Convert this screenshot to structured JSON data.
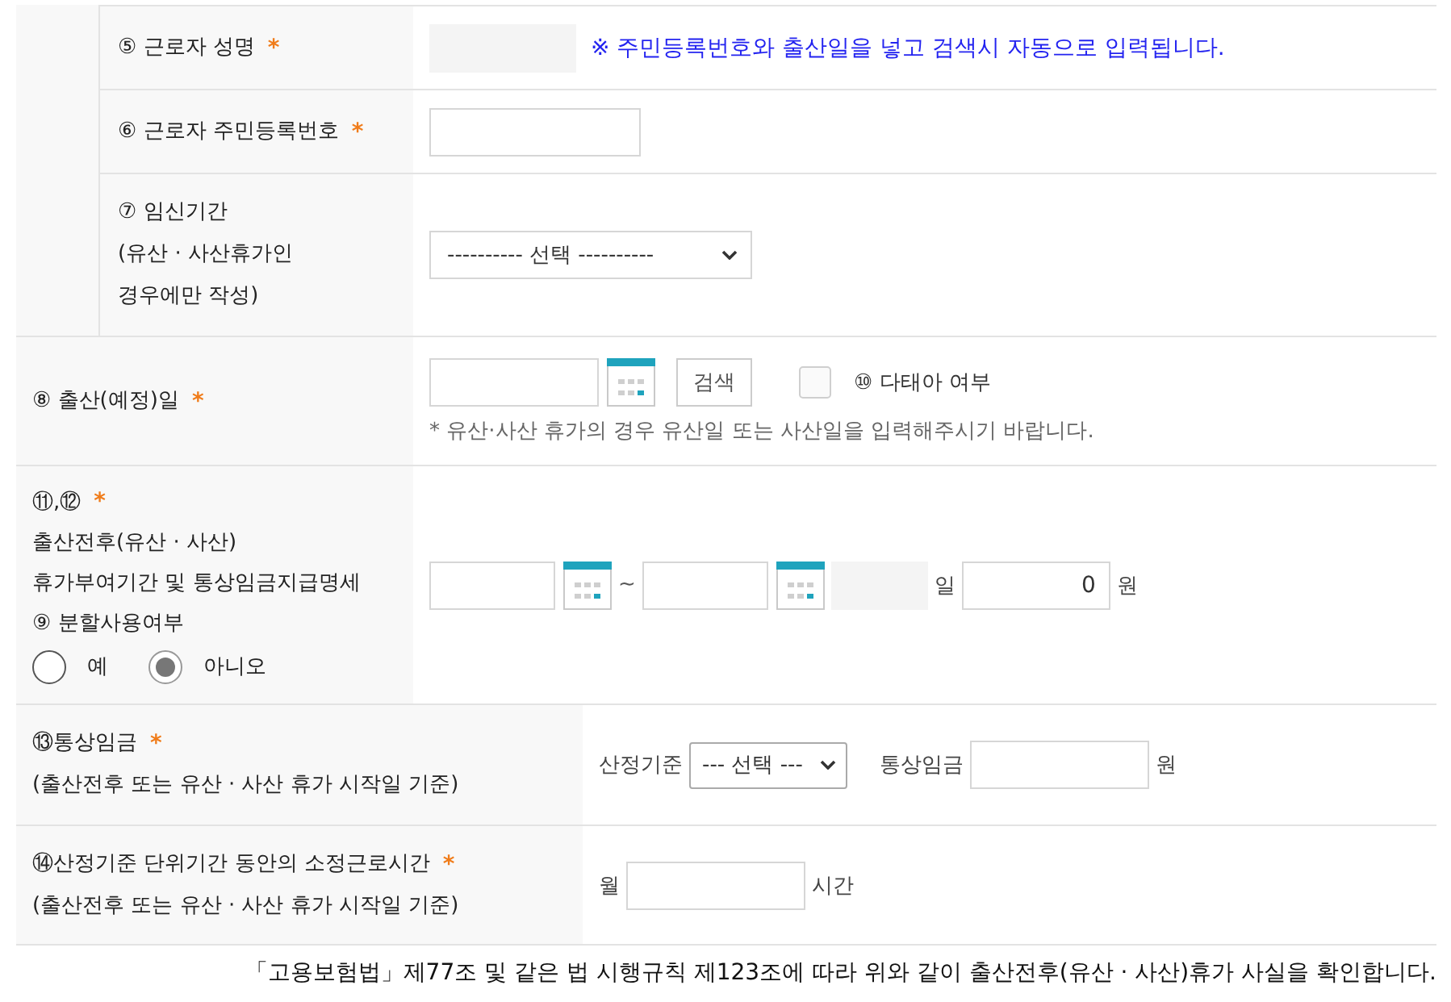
{
  "form": {
    "sections": [
      {
        "kind": "grouped",
        "rows": [
          {
            "kind": "name",
            "label_lines": [
              "⑤ 근로자 성명"
            ],
            "required_mark": "*",
            "lines": [
              [
                {
                  "kind": "readonly-field"
                },
                {
                  "kind": "note",
                  "text": "※ 주민등록번호와 출산일을 넣고 검색시 자동으로 입력됩니다."
                }
              ]
            ]
          },
          {
            "kind": "resident-number",
            "label_lines": [
              "⑥ 근로자 주민등록번호"
            ],
            "required_mark": "*",
            "lines": [
              [
                {
                  "kind": "text-field"
                }
              ]
            ]
          },
          {
            "kind": "pregnancy-period",
            "label_lines": [
              "⑦ 임신기간",
              "(유산 · 사산휴가인",
              "경우에만 작성)"
            ],
            "lines": [
              [
                {
                  "kind": "select",
                  "value": "---------- 선택 ----------"
                }
              ]
            ]
          }
        ]
      },
      {
        "kind": "plain",
        "rows": [
          {
            "kind": "birth-date",
            "label_lines": [
              "⑧ 출산(예정)일"
            ],
            "required_mark": "*",
            "lines": [
              [
                {
                  "kind": "date-field"
                },
                {
                  "kind": "calendar-button"
                },
                {
                  "kind": "button",
                  "label": "검색"
                },
                {
                  "kind": "checkbox",
                  "checked": false,
                  "label": "⑩ 다태아 여부"
                }
              ],
              [
                {
                  "kind": "hint",
                  "text": "* 유산·사산 휴가의 경우 유산일 또는 사산일을 입력해주시기 바랍니다."
                }
              ]
            ]
          },
          {
            "kind": "leave-period",
            "label_lines": [
              "⑪,⑫",
              "출산전후(유산 · 사산)",
              "휴가부여기간 및 통상임금지급명세",
              "⑨ 분할사용여부"
            ],
            "required_mark": "*",
            "radios": [
              {
                "label": "예",
                "selected": false
              },
              {
                "label": "아니오",
                "selected": true
              }
            ],
            "lines": [
              [
                {
                  "kind": "date-field"
                },
                {
                  "kind": "calendar-button"
                },
                {
                  "kind": "separator",
                  "text": "~"
                },
                {
                  "kind": "date-field"
                },
                {
                  "kind": "calendar-button"
                },
                {
                  "kind": "readonly-field"
                },
                {
                  "kind": "unit",
                  "text": "일"
                },
                {
                  "kind": "number-field",
                  "value": "0"
                },
                {
                  "kind": "unit",
                  "text": "원"
                }
              ]
            ]
          }
        ]
      },
      {
        "kind": "wide",
        "rows": [
          {
            "kind": "wage",
            "label_lines": [
              "⑬통상임금",
              "(출산전후 또는 유산 · 사산 휴가 시작일 기준)"
            ],
            "required_mark": "*",
            "lines": [
              [
                {
                  "kind": "caption",
                  "text": "산정기준"
                },
                {
                  "kind": "select",
                  "value": "--- 선택 ---"
                },
                {
                  "kind": "caption",
                  "text": "통상임금"
                },
                {
                  "kind": "text-field"
                },
                {
                  "kind": "unit",
                  "text": "원"
                }
              ]
            ]
          },
          {
            "kind": "hours",
            "label_lines": [
              "⑭산정기준 단위기간 동안의 소정근로시간",
              "(출산전후 또는 유산 · 사산 휴가 시작일 기준)"
            ],
            "required_mark": "*",
            "lines": [
              [
                {
                  "kind": "caption",
                  "text": "월"
                },
                {
                  "kind": "text-field"
                },
                {
                  "kind": "unit",
                  "text": "시간"
                }
              ]
            ]
          }
        ]
      }
    ]
  },
  "footer": "「고용보험법」제77조 및 같은 법 시행규칙 제123조에 따라 위와 같이 출산전후(유산 · 사산)휴가 사실을 확인합니다."
}
